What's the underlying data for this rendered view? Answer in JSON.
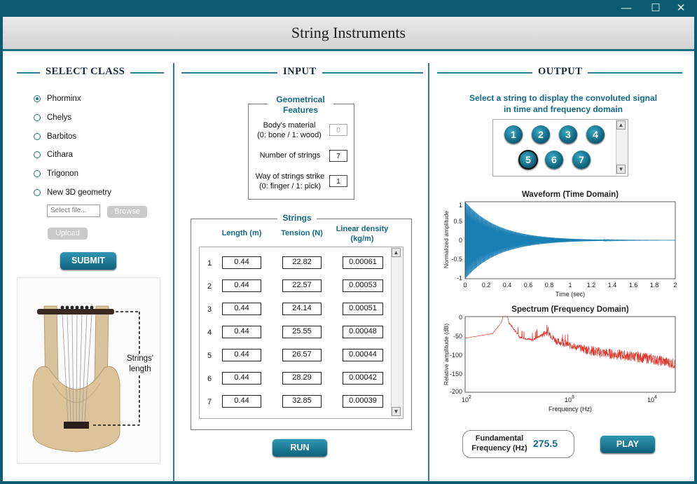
{
  "window": {
    "minimize": "—",
    "maximize": "☐",
    "close": "✕"
  },
  "app_title": "String Instruments",
  "select_class": {
    "title": "SELECT CLASS",
    "options": [
      {
        "label": "Phorminx",
        "selected": true
      },
      {
        "label": "Chelys",
        "selected": false
      },
      {
        "label": "Barbitos",
        "selected": false
      },
      {
        "label": "Cithara",
        "selected": false
      },
      {
        "label": "Trigonon",
        "selected": false
      },
      {
        "label": "New 3D geometry",
        "selected": false
      }
    ],
    "file_placeholder": "Select file...",
    "browse_label": "Browse",
    "upload_label": "Upload",
    "submit_label": "SUBMIT",
    "image_annotation_line1": "Strings'",
    "image_annotation_line2": "length"
  },
  "input": {
    "title": "INPUT",
    "geometrical": {
      "title_line1": "Geometrical",
      "title_line2": "Features",
      "body_material_line1": "Body's material",
      "body_material_line2": "(0: bone / 1: wood)",
      "body_material_value": "0",
      "num_strings_label": "Number of strings",
      "num_strings_value": "7",
      "strike_line1": "Way of strings strike",
      "strike_line2": "(0: finger / 1: pick)",
      "strike_value": "1"
    },
    "strings": {
      "title": "Strings",
      "col_length": "Length (m)",
      "col_tension": "Tension (N)",
      "col_density_line1": "Linear density",
      "col_density_line2": "(kg/m)",
      "rows": [
        {
          "n": "1",
          "length": "0.44",
          "tension": "22.82",
          "density": "0.00061"
        },
        {
          "n": "2",
          "length": "0.44",
          "tension": "22.57",
          "density": "0.00053"
        },
        {
          "n": "3",
          "length": "0.44",
          "tension": "24.14",
          "density": "0.00051"
        },
        {
          "n": "4",
          "length": "0.44",
          "tension": "25.55",
          "density": "0.00048"
        },
        {
          "n": "5",
          "length": "0.44",
          "tension": "26.57",
          "density": "0.00044"
        },
        {
          "n": "6",
          "length": "0.44",
          "tension": "28.29",
          "density": "0.00042"
        },
        {
          "n": "7",
          "length": "0.44",
          "tension": "32.85",
          "density": "0.00039"
        }
      ]
    },
    "run_label": "RUN"
  },
  "output": {
    "title": "OUTPUT",
    "instruction_line1": "Select a string to display the convoluted signal",
    "instruction_line2": "in time and frequency domain",
    "string_buttons": [
      "1",
      "2",
      "3",
      "4",
      "5",
      "6",
      "7"
    ],
    "selected_string": "5",
    "waveform": {
      "title": "Waveform (Time Domain)",
      "xlabel": "Time (sec)",
      "ylabel": "Normalized amplitude",
      "xticks": [
        "0",
        "0.2",
        "0.4",
        "0.6",
        "0.8",
        "1",
        "1.2",
        "1.4",
        "1.6",
        "1.8",
        "2"
      ],
      "yticks": [
        "1",
        "0.5",
        "0",
        "-0.5",
        "-1"
      ],
      "color": "#1a7fb4"
    },
    "spectrum": {
      "title": "Spectrum (Frequency Domain)",
      "xlabel": "Frequency (Hz)",
      "ylabel": "Relative amplitude (dB)",
      "yticks": [
        "0",
        "-50",
        "-100",
        "-150",
        "-200"
      ],
      "xticks": [
        "10",
        "2",
        "10",
        "3",
        "10",
        "4"
      ],
      "color": "#e0352b"
    },
    "fundamental_label_line1": "Fundamental",
    "fundamental_label_line2": "Frequency (Hz)",
    "fundamental_value": "275.5",
    "play_label": "PLAY"
  },
  "chart_data": [
    {
      "type": "line",
      "title": "Waveform (Time Domain)",
      "xlabel": "Time (sec)",
      "ylabel": "Normalized amplitude",
      "xlim": [
        0,
        2
      ],
      "ylim": [
        -1,
        1
      ],
      "series": [
        {
          "envelope_peak": [
            [
              0,
              1.0
            ],
            [
              0.2,
              0.55
            ],
            [
              0.4,
              0.3
            ],
            [
              0.6,
              0.15
            ],
            [
              0.8,
              0.07
            ],
            [
              1.0,
              0.03
            ],
            [
              1.2,
              0.015
            ],
            [
              1.4,
              0.007
            ],
            [
              2.0,
              0.0
            ]
          ]
        }
      ]
    },
    {
      "type": "line",
      "title": "Spectrum (Frequency Domain)",
      "xlabel": "Frequency (Hz)",
      "ylabel": "Relative amplitude (dB)",
      "xscale": "log",
      "xlim": [
        100,
        20000
      ],
      "ylim": [
        -200,
        0
      ],
      "series": [
        {
          "points": [
            [
              100,
              -57
            ],
            [
              200,
              -45
            ],
            [
              275.5,
              -3
            ],
            [
              400,
              -55
            ],
            [
              550,
              -62
            ],
            [
              800,
              -40
            ],
            [
              1000,
              -65
            ],
            [
              1600,
              -80
            ],
            [
              3000,
              -95
            ],
            [
              10000,
              -110
            ],
            [
              20000,
              -125
            ]
          ]
        }
      ]
    }
  ]
}
